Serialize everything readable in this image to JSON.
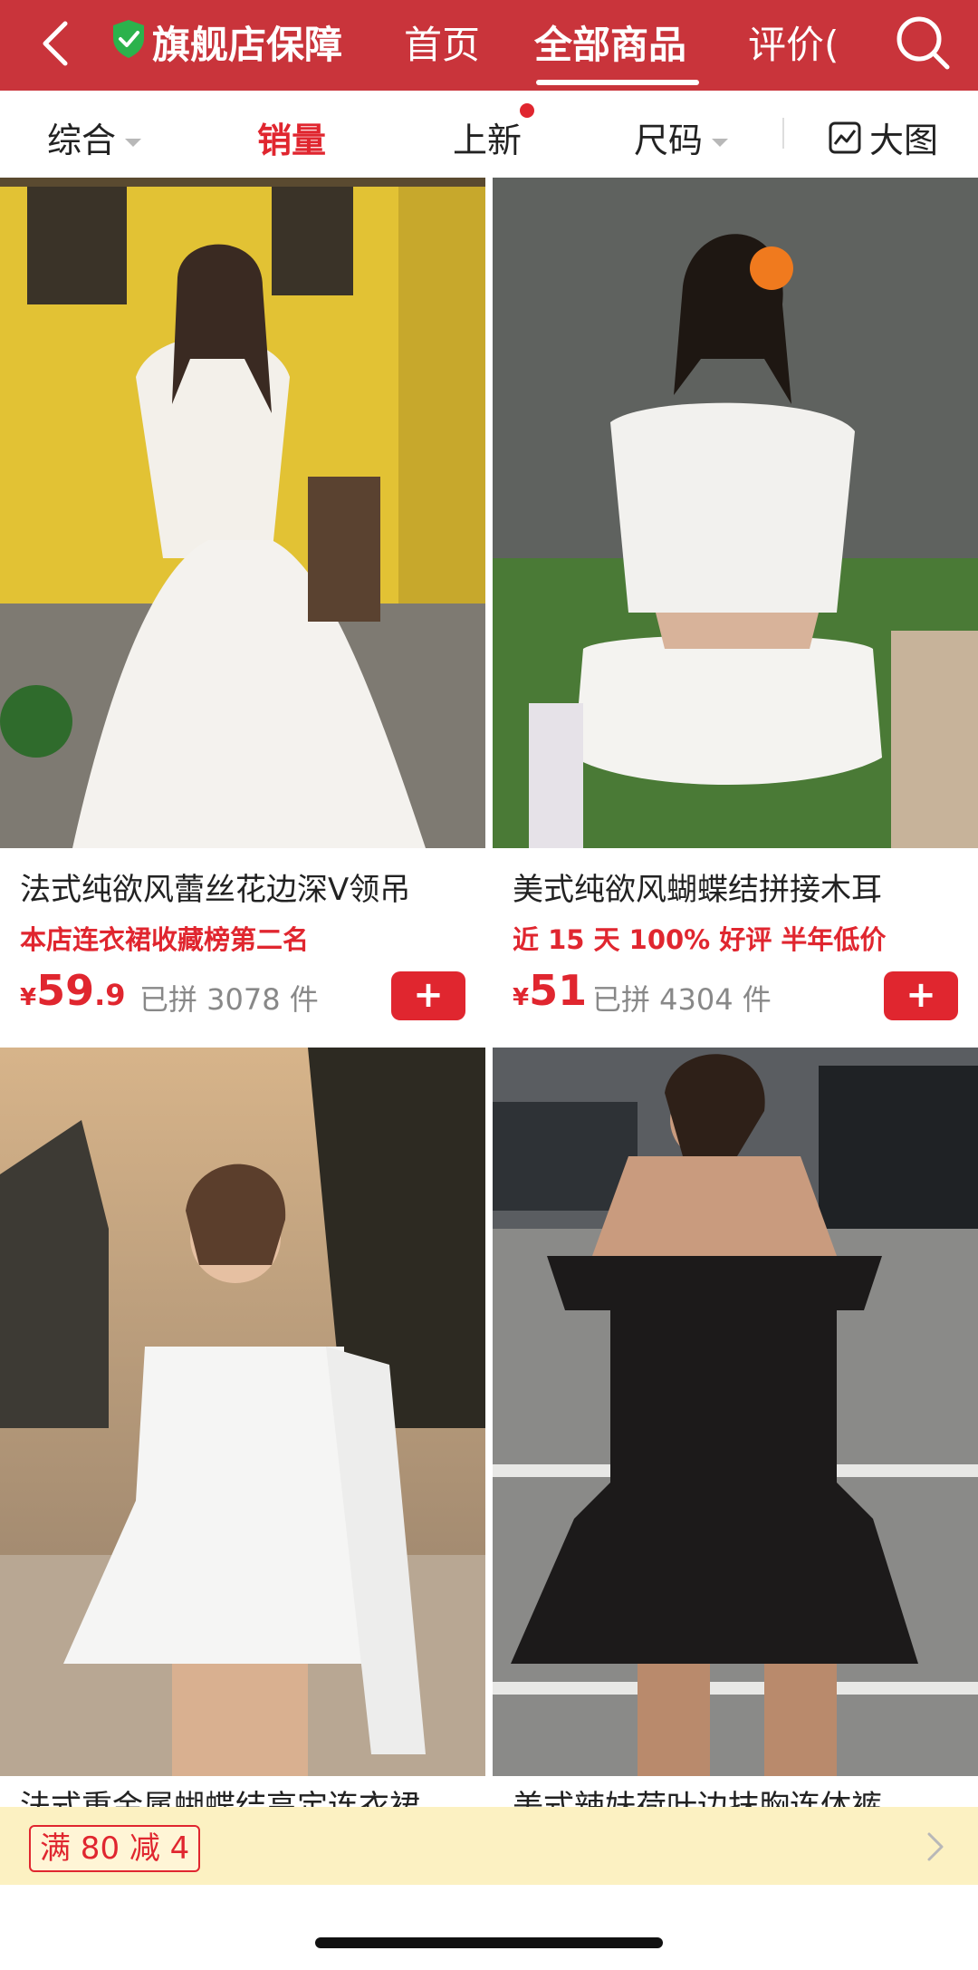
{
  "header": {
    "back_icon": "chevron-left-icon",
    "shield_icon": "shield-check-icon",
    "brand_label": "旗舰店保障",
    "tabs": [
      {
        "label": "首页"
      },
      {
        "label": "全部商品"
      },
      {
        "label": "评价("
      }
    ],
    "search_icon": "search-icon",
    "accent_color": "#c9343b"
  },
  "filters": {
    "items": [
      {
        "label": "综合"
      },
      {
        "label": "销量"
      },
      {
        "label": "上新"
      },
      {
        "label": "尺码"
      }
    ],
    "big_image_label": "大图"
  },
  "products": [
    {
      "title": "法式纯欲风蕾丝花边深V领吊",
      "tagline": "本店连衣裙收藏榜第二名",
      "price_symbol": "¥",
      "price_int": "59",
      "price_dec": ".9",
      "sold": "已拼 3078 件",
      "add_label": "+"
    },
    {
      "title": "美式纯欲风蝴蝶结拼接木耳",
      "tagline": "近 15 天 100% 好评  半年低价",
      "price_symbol": "¥",
      "price_int": "51",
      "price_dec": "",
      "sold": "已拼 4304 件",
      "add_label": "+"
    },
    {
      "title": "法式重金属蝴蝶结高定连衣裙"
    },
    {
      "title": "美式辣妹荷叶边抹胸连体裤"
    }
  ],
  "promo": {
    "badge": "满 80 减 4",
    "chevron_icon": "chevron-right-icon"
  },
  "colors": {
    "price_red": "#e0262f",
    "promo_bg": "#fcf1c2"
  }
}
